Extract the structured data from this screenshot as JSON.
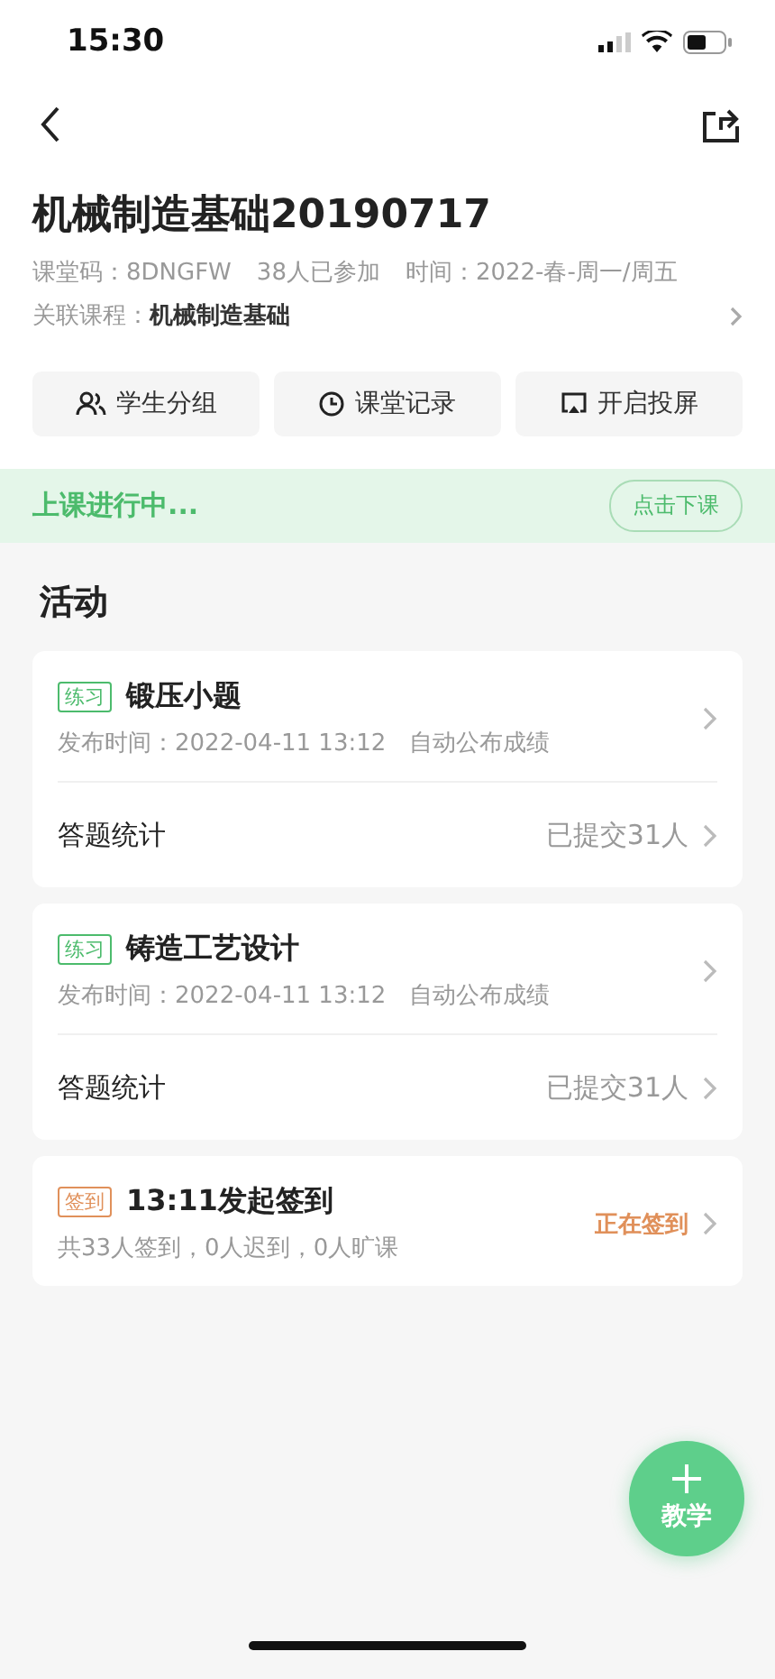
{
  "status_bar": {
    "time": "15:30"
  },
  "course": {
    "title": "机械制造基础20190717",
    "code_label": "课堂码：",
    "code": "8DNGFW",
    "joined": "38人已参加",
    "time_label": "时间：",
    "time": "2022-春-周一/周五",
    "linked_label": "关联课程：",
    "linked": "机械制造基础"
  },
  "actions": [
    {
      "label": "学生分组",
      "kind": "group"
    },
    {
      "label": "课堂记录",
      "kind": "record"
    },
    {
      "label": "开启投屏",
      "kind": "cast"
    }
  ],
  "banner": {
    "status": "上课进行中...",
    "button": "点击下课"
  },
  "section_title": "活动",
  "activities": [
    {
      "kind": "exercise",
      "tag": "练习",
      "color": "#4cbb6c",
      "title": "锻压小题",
      "meta": "发布时间：2022-04-11 13:12　自动公布成绩",
      "stats_label": "答题统计",
      "stats_value": "已提交31人"
    },
    {
      "kind": "exercise",
      "tag": "练习",
      "color": "#4cbb6c",
      "title": "铸造工艺设计",
      "meta": "发布时间：2022-04-11 13:12　自动公布成绩",
      "stats_label": "答题统计",
      "stats_value": "已提交31人"
    },
    {
      "kind": "checkin",
      "tag": "签到",
      "color": "#e0905a",
      "title": "13:11发起签到",
      "meta": "共33人签到，0人迟到，0人旷课",
      "status": "正在签到"
    }
  ],
  "fab": {
    "label": "教学"
  }
}
